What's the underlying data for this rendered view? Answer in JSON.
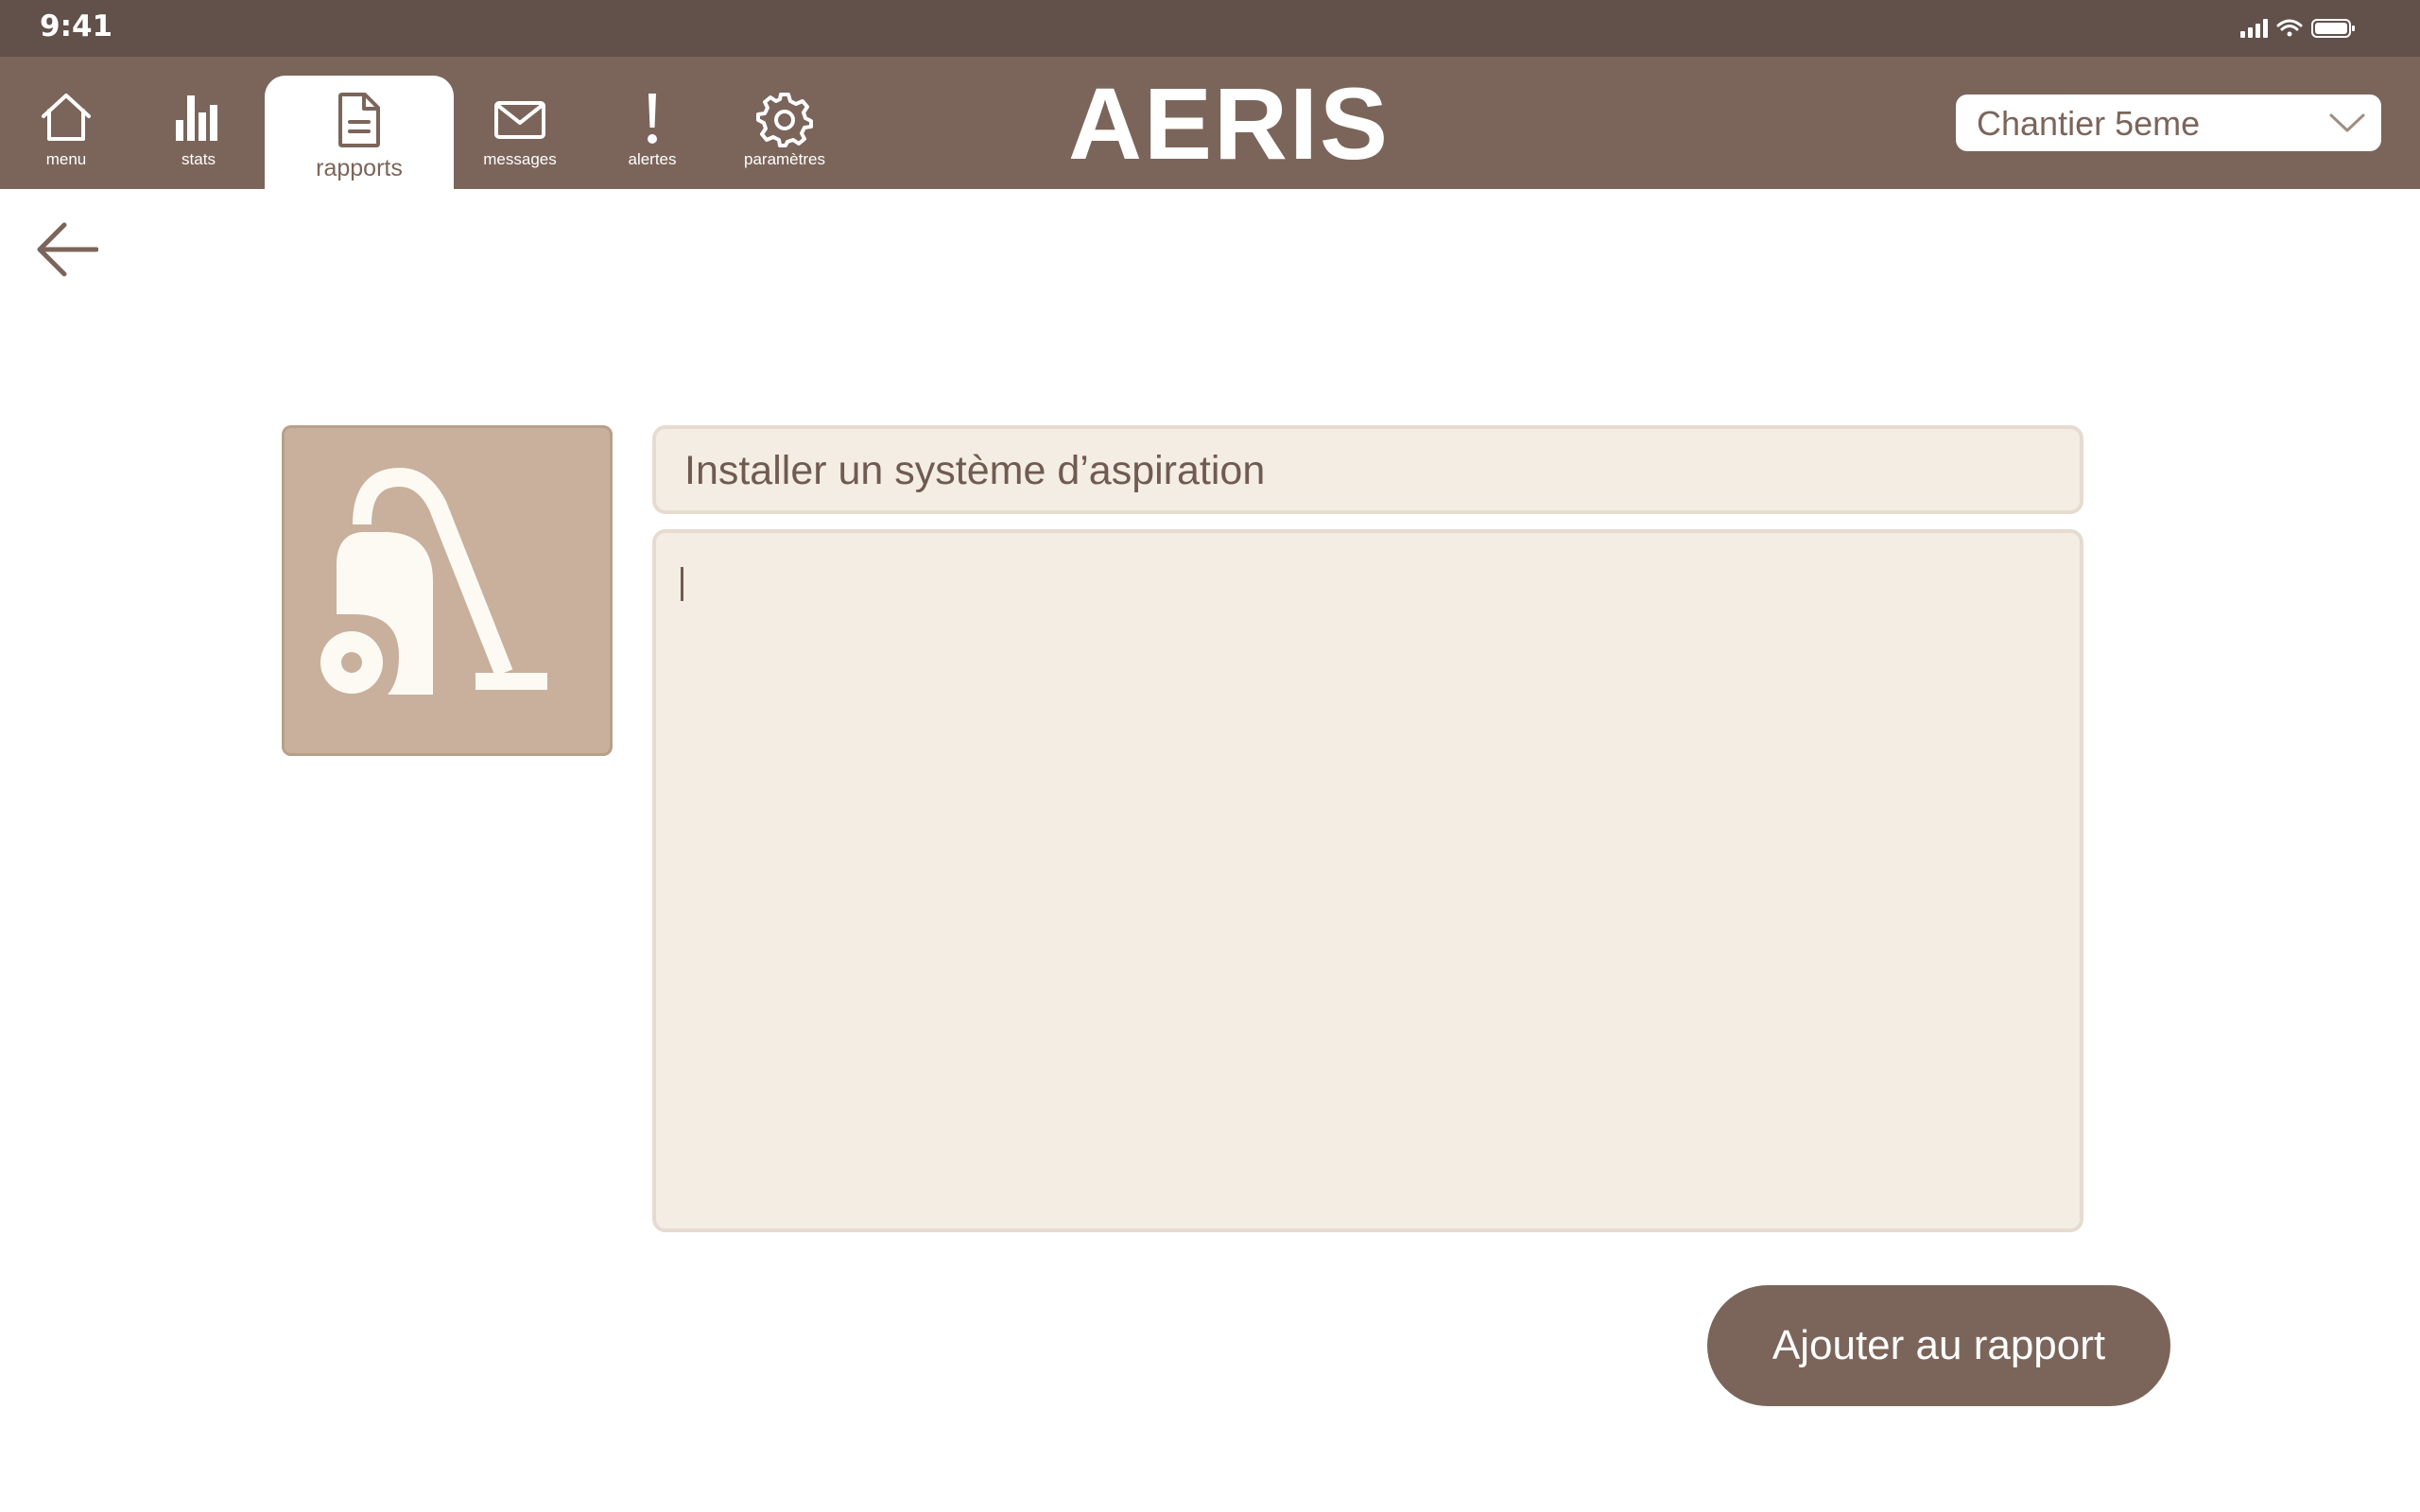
{
  "status_bar": {
    "time": "9:41"
  },
  "nav": {
    "items": [
      {
        "label": "menu",
        "icon": "home-icon"
      },
      {
        "label": "stats",
        "icon": "bar-chart-icon"
      },
      {
        "label": "rapports",
        "icon": "document-icon",
        "active": true
      },
      {
        "label": "messages",
        "icon": "envelope-icon"
      },
      {
        "label": "alertes",
        "icon": "exclamation-icon"
      },
      {
        "label": "paramètres",
        "icon": "gear-icon"
      }
    ],
    "brand": "AERIS",
    "site_select": {
      "value": "Chantier 5eme"
    }
  },
  "form": {
    "task_icon": "vacuum-cleaner-icon",
    "title_value": "Installer un système d’aspiration",
    "description_value": ""
  },
  "actions": {
    "add_label": "Ajouter au rapport"
  },
  "colors": {
    "nav_background": "#7b655a",
    "status_background": "#61514a",
    "field_background": "#f4ede4",
    "thumb_background": "#c8b09c"
  }
}
